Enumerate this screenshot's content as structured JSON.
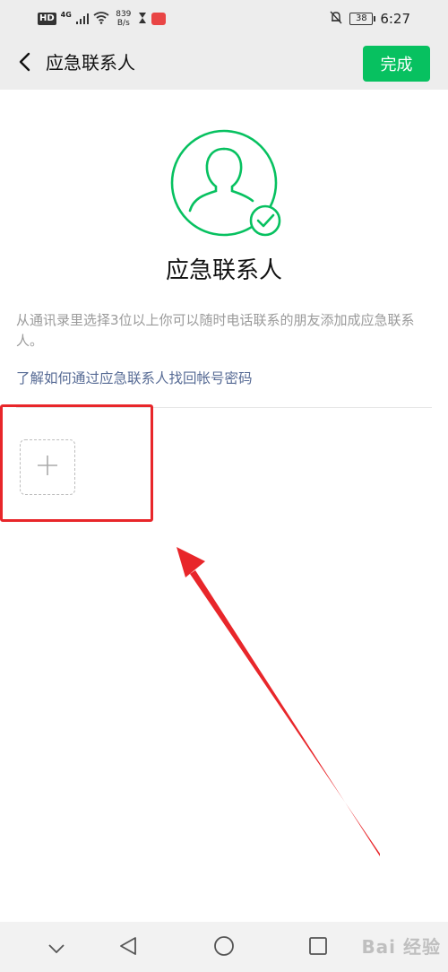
{
  "status_bar": {
    "hd": "HD",
    "network": "4G",
    "speed_value": "839",
    "speed_unit": "B/s",
    "battery": "38",
    "time": "6:27"
  },
  "navbar": {
    "title": "应急联系人",
    "done_label": "完成"
  },
  "main": {
    "title": "应急联系人",
    "description": "从通讯录里选择3位以上你可以随时电话联系的朋友添加成应急联系人。",
    "link": "了解如何通过应急联系人找回帐号密码"
  },
  "watermark": "Bai 经验",
  "colors": {
    "accent": "#07c160",
    "link": "#576b95",
    "annotation": "#e8262a",
    "navbar_bg": "#ededed"
  },
  "icons": [
    "back-icon",
    "avatar-check-icon",
    "plus-icon",
    "mute-icon",
    "wifi-icon",
    "signal-icon",
    "hourglass-icon",
    "collapse-icon",
    "nav-back-icon",
    "home-icon",
    "recents-icon"
  ]
}
